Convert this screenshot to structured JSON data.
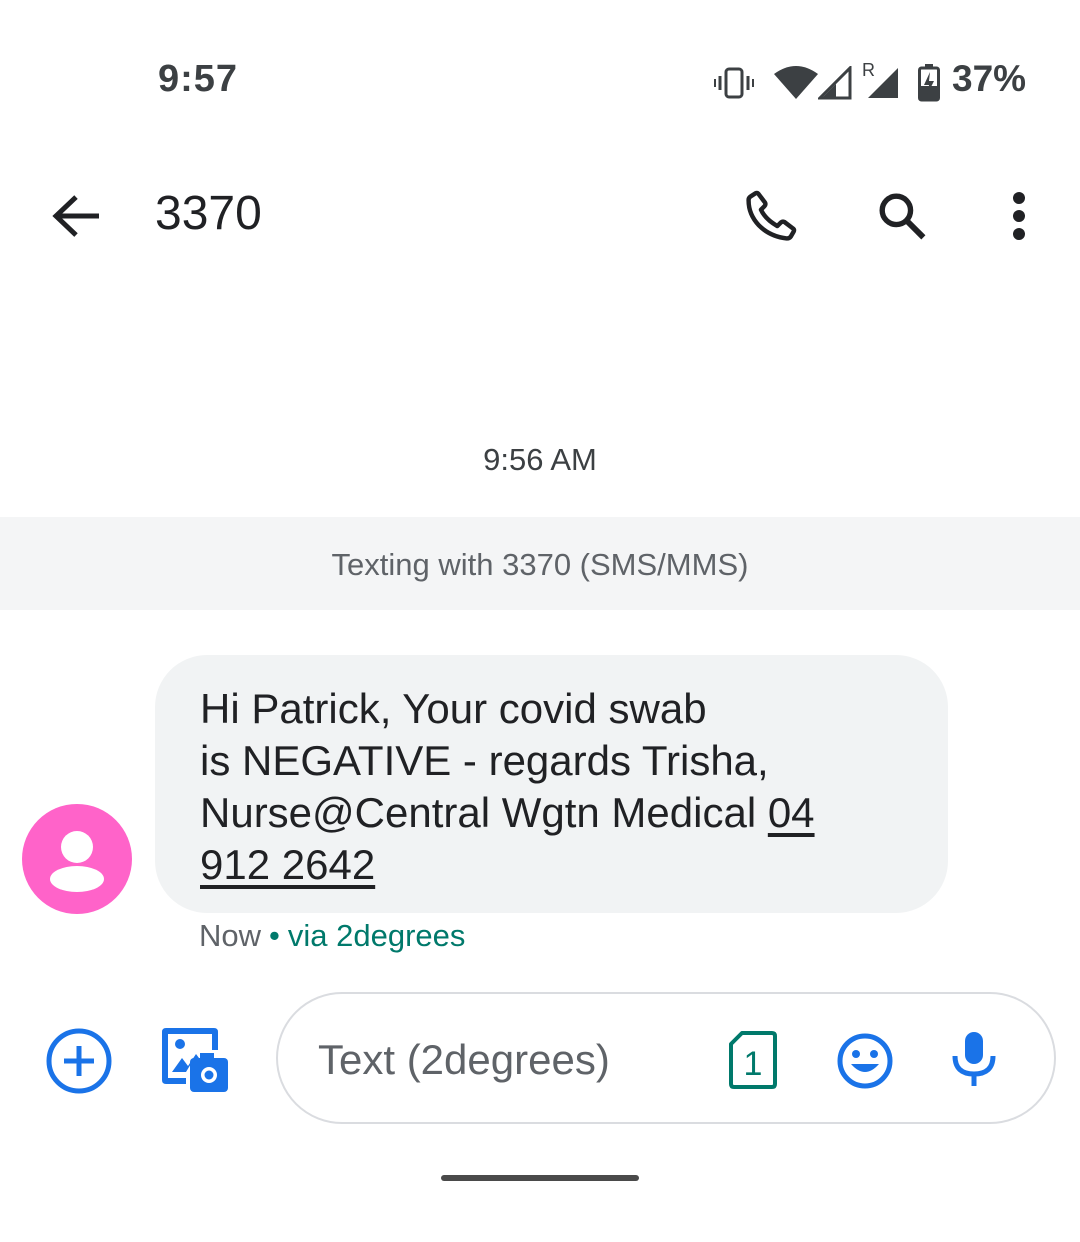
{
  "status_bar": {
    "time": "9:57",
    "roaming_indicator": "R",
    "battery_percent": "37%",
    "icons": [
      "vibrate-icon",
      "wifi-icon",
      "signal-icon",
      "signal-roaming-icon",
      "battery-charging-icon"
    ]
  },
  "app_bar": {
    "title": "3370",
    "back_icon": "arrow-back-icon",
    "actions": [
      "phone-icon",
      "search-icon",
      "more-vert-icon"
    ]
  },
  "conversation": {
    "timestamp": "9:56 AM",
    "banner": "Texting with 3370 (SMS/MMS)",
    "messages": [
      {
        "text_line1": "Hi Patrick,  Your covid swab",
        "text_line2": "is NEGATIVE - regards Trisha,",
        "text_line3": "Nurse@Central Wgtn Medical ",
        "phone_link_part1": "04",
        "phone_link_part2": "912 2642",
        "time": "Now",
        "separator": "•",
        "carrier": "via 2degrees",
        "avatar_color": "#ff63c9"
      }
    ]
  },
  "compose": {
    "placeholder": "Text (2degrees)",
    "sim_number": "1",
    "accent_color": "#1a73e8",
    "sim_color": "#00796b"
  }
}
